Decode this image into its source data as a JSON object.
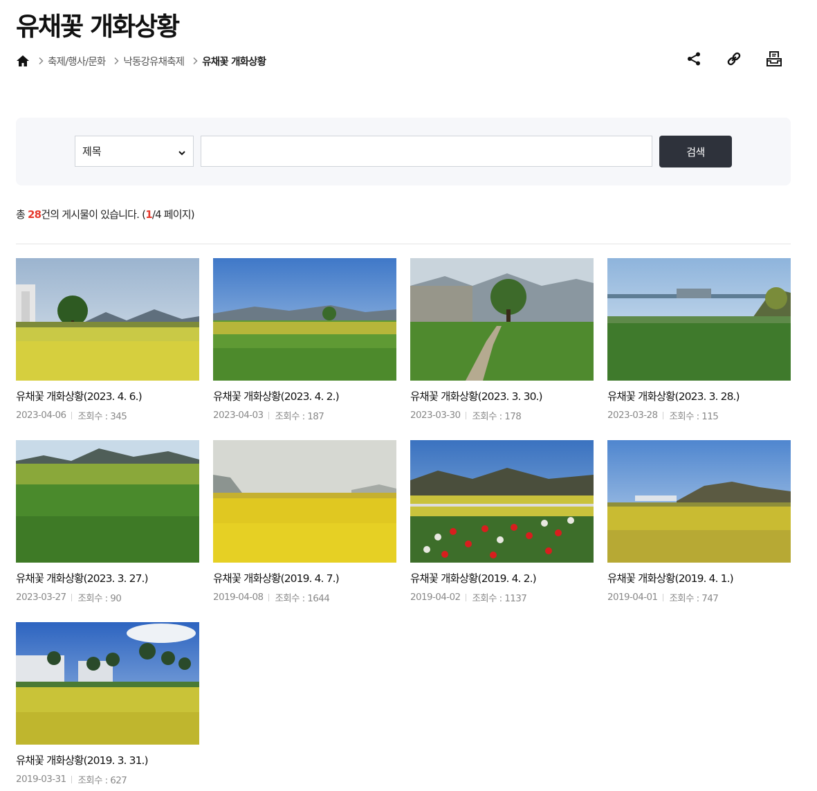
{
  "page": {
    "title": "유채꽃 개화상황",
    "breadcrumb": [
      {
        "label": "축제/행사/문화"
      },
      {
        "label": "낙동강유채축제"
      },
      {
        "label": "유채꽃 개화상황"
      }
    ]
  },
  "tools": [
    {
      "icon": "share-icon"
    },
    {
      "icon": "link-icon"
    },
    {
      "icon": "print-icon"
    }
  ],
  "search": {
    "select_value": "제목",
    "input_value": "",
    "button_label": "검색"
  },
  "summary": {
    "prefix": "총 ",
    "total": "28",
    "middle": "건의 게시물이 있습니다. (",
    "current_page": "1",
    "suffix": "/4 페이지)"
  },
  "posts": [
    {
      "title": "유채꽃 개화상황(2023. 4. 6.)",
      "date": "2023-04-06",
      "views": "조회수 : 345"
    },
    {
      "title": "유채꽃 개화상황(2023. 4. 2.)",
      "date": "2023-04-03",
      "views": "조회수 : 187"
    },
    {
      "title": "유채꽃 개화상황(2023. 3. 30.)",
      "date": "2023-03-30",
      "views": "조회수 : 178"
    },
    {
      "title": "유채꽃 개화상황(2023. 3. 28.)",
      "date": "2023-03-28",
      "views": "조회수 : 115"
    },
    {
      "title": "유채꽃 개화상황(2023. 3. 27.)",
      "date": "2023-03-27",
      "views": "조회수 : 90"
    },
    {
      "title": "유채꽃 개화상황(2019. 4. 7.)",
      "date": "2019-04-08",
      "views": "조회수 : 1644"
    },
    {
      "title": "유채꽃 개화상황(2019. 4. 2.)",
      "date": "2019-04-02",
      "views": "조회수 : 1137"
    },
    {
      "title": "유채꽃 개화상황(2019. 4. 1.)",
      "date": "2019-04-01",
      "views": "조회수 : 747"
    },
    {
      "title": "유채꽃 개화상황(2019. 3. 31.)",
      "date": "2019-03-31",
      "views": "조회수 : 627"
    }
  ],
  "colors": {
    "accent_red": "#e63a2e",
    "button_dark": "#2e323b",
    "search_bg": "#f6f7fa"
  }
}
